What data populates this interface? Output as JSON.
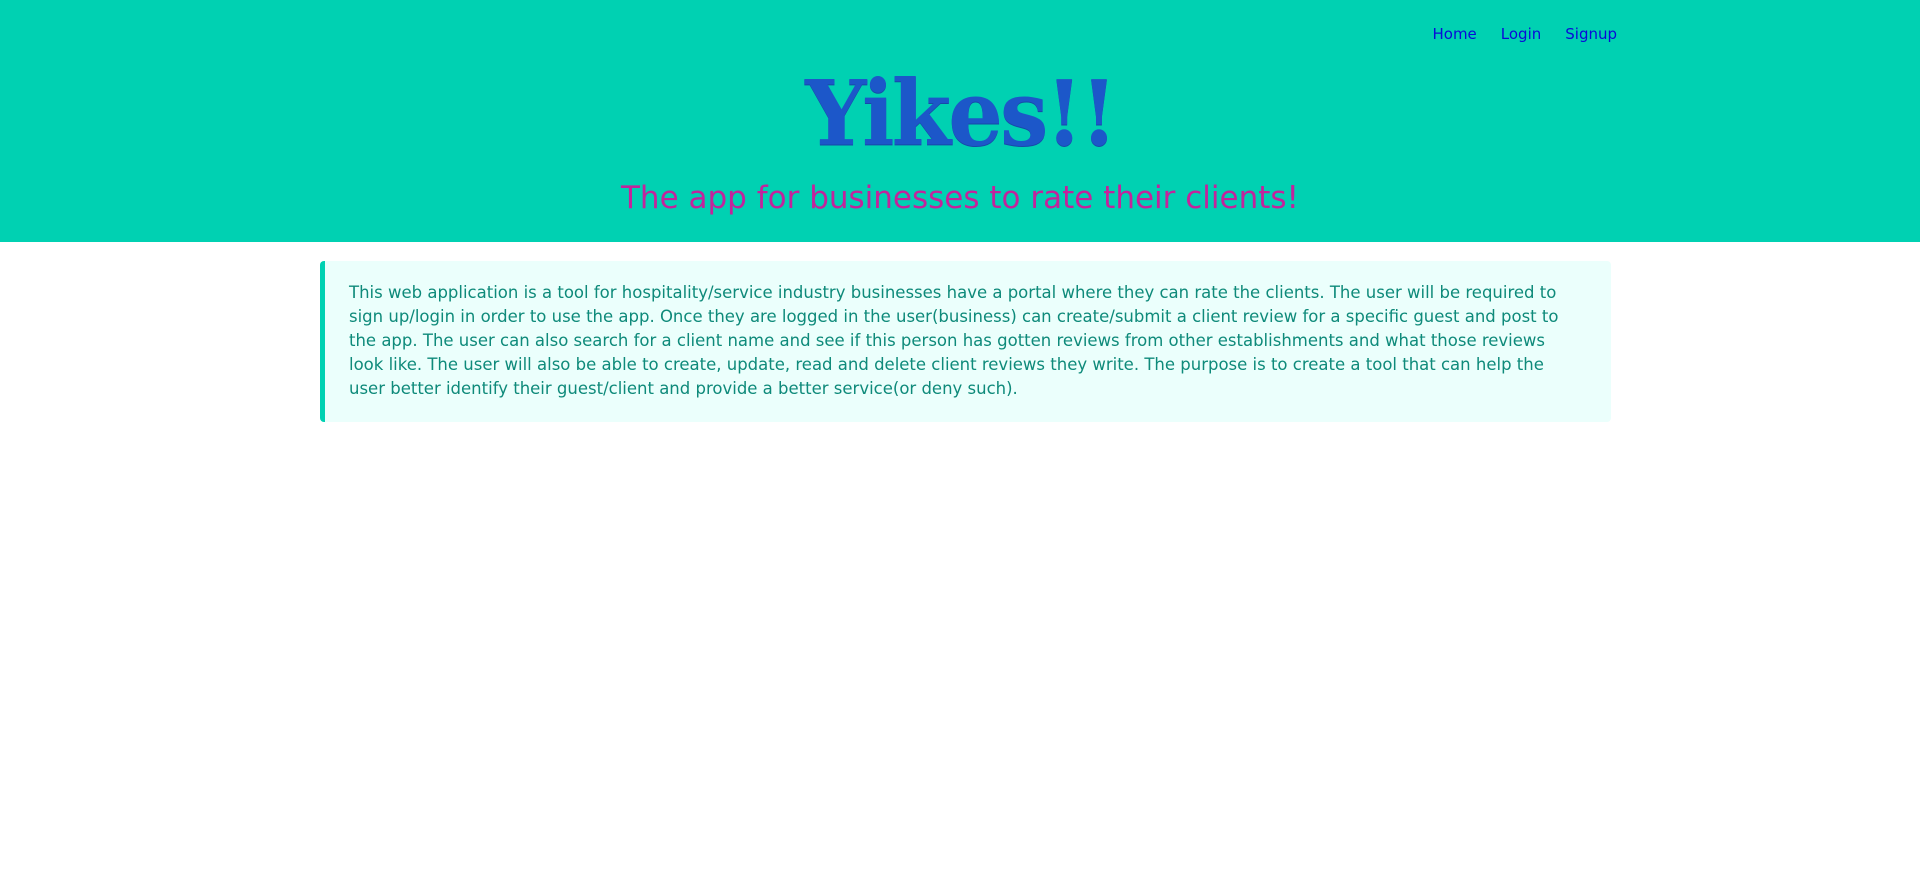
{
  "nav": {
    "home": "Home",
    "login": "Login",
    "signup": "Signup"
  },
  "hero": {
    "brand": "Yikes!!",
    "tagline": "The app for businesses to rate their clients!"
  },
  "notice": {
    "text": "This web application is a tool for hospitality/service industry businesses have a portal where they can rate the clients. The user will be required to sign up/login in order to use the app. Once they are logged in the user(business) can create/submit a client review for a specific guest and post to the app. The user can also search for a client name and see if this person has gotten reviews from other establishments and what those reviews look like. The user will also be able to create, update, read and delete client reviews they write. The purpose is to create a tool that can help the user better identify their guest/client and provide a better service(or deny such)."
  },
  "colors": {
    "hero_background": "#00d1b2",
    "nav_link": "#0a0ad8",
    "brand": "#1c57c9",
    "tagline": "#c2249c",
    "notice_background": "#ebfffc",
    "notice_text": "#0e8a7a"
  }
}
